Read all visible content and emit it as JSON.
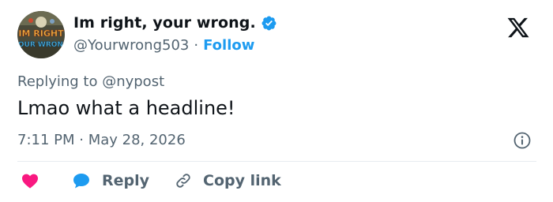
{
  "author": {
    "display_name": "Im right, your wrong.",
    "handle": "@Yourwrong503",
    "avatar_text_top": "IM RIGHT",
    "avatar_text_bottom": "YOUR WRONG"
  },
  "header": {
    "separator": "·",
    "follow_label": "Follow",
    "logo_icon": "x-logo-icon"
  },
  "tweet": {
    "replying_to": "Replying to @nypost",
    "text": "Lmao what a headline!",
    "timestamp": "7:11 PM · May 28, 2026"
  },
  "actions": {
    "reply_label": "Reply",
    "copy_link_label": "Copy link"
  },
  "colors": {
    "accent": "#1d9bf0",
    "like": "#f91880",
    "text_secondary": "#536471",
    "text_primary": "#0f1419"
  }
}
